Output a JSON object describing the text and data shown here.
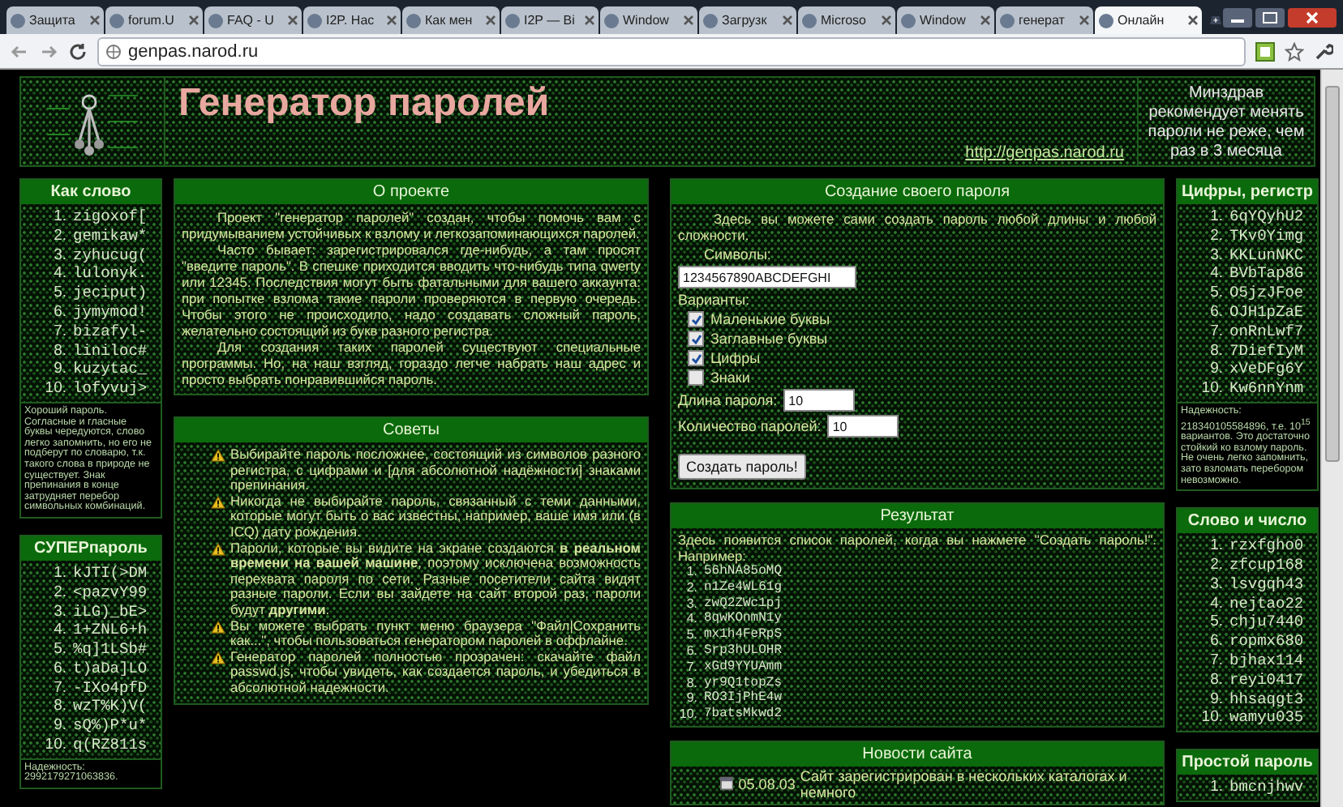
{
  "browser": {
    "tabs": [
      {
        "label": "Защита",
        "selected": false
      },
      {
        "label": "forum.U",
        "selected": false
      },
      {
        "label": "FAQ - U",
        "selected": false
      },
      {
        "label": "I2P. Нас",
        "selected": false
      },
      {
        "label": "Как мен",
        "selected": false
      },
      {
        "label": "I2P — Bi",
        "selected": false
      },
      {
        "label": "Window",
        "selected": false
      },
      {
        "label": "Загрузк",
        "selected": false
      },
      {
        "label": "Microso",
        "selected": false
      },
      {
        "label": "Window",
        "selected": false
      },
      {
        "label": "генерат",
        "selected": false
      },
      {
        "label": "Онлайн",
        "selected": true
      }
    ],
    "address": "genpas.narod.ru"
  },
  "header": {
    "title": "Генератор паролей",
    "link": "http://genpas.narod.ru",
    "notice": "Минздрав рекомендует менять пароли не реже, чем раз в 3 месяца"
  },
  "left_column": [
    {
      "title": "Как слово",
      "items": [
        [
          "1.",
          "zigoxof["
        ],
        [
          "2.",
          "gemikaw*"
        ],
        [
          "3.",
          "zyhucug("
        ],
        [
          "4.",
          "lulonyk."
        ],
        [
          "5.",
          "jeciput)"
        ],
        [
          "6.",
          "jymymod!"
        ],
        [
          "7.",
          "bizafyl-"
        ],
        [
          "8.",
          "liniloc#"
        ],
        [
          "9.",
          "kuzytac_"
        ],
        [
          "10.",
          "lofyvuj>"
        ]
      ],
      "note": "Хороший пароль. Согласные и гласные буквы чередуются, слово легко запомнить, но его не подберут по словарю, т.к. такого слова в природе не существует. Знак препинания в конце затрудняет перебор символьных комбинаций."
    },
    {
      "title": "СУПЕРпароль",
      "items": [
        [
          "1.",
          "kJTI(>DM"
        ],
        [
          "2.",
          "<pazvY99"
        ],
        [
          "3.",
          "iLG)_bE>"
        ],
        [
          "4.",
          "1+ZNL6+h"
        ],
        [
          "5.",
          "%q]1LSb#"
        ],
        [
          "6.",
          "t)aDa]LO"
        ],
        [
          "7.",
          "-IXo4pfD"
        ],
        [
          "8.",
          "wzT%K)V("
        ],
        [
          "9.",
          "sQ%)P*u*"
        ],
        [
          "10.",
          "q(RZ811s"
        ]
      ],
      "note": "Надежность: 2992179271063836."
    }
  ],
  "about": {
    "title": "О проекте",
    "paragraphs": [
      "Проект \"генератор паролей\" создан, чтобы помочь вам с придумыванием устойчивых к взлому и легкозапоминающихся паролей.",
      "Часто бывает: зарегистрировался где-нибудь, а там просят \"введите пароль\". В спешке приходится вводить что-нибудь типа qwerty или 12345. Последствия могут быть фатальными для вашего аккаунта: при попытке взлома такие пароли проверяются в первую очередь. Чтобы этого не происходило, надо создавать сложный пароль, желательно состоящий из букв разного регистра.",
      "Для создания таких паролей существуют специальные программы. Но, на наш взгляд, гораздо легче набрать наш адрес и просто выбрать понравившийся пароль."
    ]
  },
  "tips": {
    "title": "Советы",
    "items": [
      "Выбирайте пароль посложнее, состоящий из символов разного регистра, с цифрами и [для абсолютной надёжности] знаками препинания.",
      "Никогда не выбирайте пароль, связанный с теми данными, которые могут быть о вас известны, например, ваше имя или (в ICQ) дату рождения.",
      "Пароли, которые вы видите на экране создаются **в реальном времени на вашей машине**, поэтому исключена возможность перехвата пароля по сети. Разные посетители сайта видят разные пароли. Если вы зайдете на сайт второй раз, пароли будут **другими**.",
      "Вы можете выбрать пункт меню браузера \"Файл|Сохранить как...\", чтобы пользоваться генератором паролей в оффлайне.",
      "Генератор паролей полностью прозрачен: скачайте файл passwd.js, чтобы увидеть, как создается пароль, и убедиться в абсолютной надежности."
    ]
  },
  "create": {
    "title": "Создание своего пароля",
    "intro": "Здесь вы можете сами создать пароль любой длины и любой сложности.",
    "symbols_label": "Символы:",
    "symbols_value": "1234567890ABCDEFGHI",
    "options_label": "Варианты:",
    "options": [
      {
        "label": "Маленькие буквы",
        "checked": true
      },
      {
        "label": "Заглавные буквы",
        "checked": true
      },
      {
        "label": "Цифры",
        "checked": true
      },
      {
        "label": "Знаки",
        "checked": false
      }
    ],
    "length_label": "Длина пароля:",
    "length_value": "10",
    "count_label": "Количество паролей:",
    "count_value": "10",
    "button": "Создать пароль!"
  },
  "result": {
    "title": "Результат",
    "intro": "Здесь появится список паролей, когда вы нажмете \"Создать пароль!\". Например:",
    "items": [
      [
        "1.",
        "56hNA85oMQ"
      ],
      [
        "2.",
        "n1Ze4WL61g"
      ],
      [
        "3.",
        "zwQ2ZWc1pj"
      ],
      [
        "4.",
        "8qwKOnmN1y"
      ],
      [
        "5.",
        "mx1h4FeRpS"
      ],
      [
        "6.",
        "Srp3hULOHR"
      ],
      [
        "7.",
        "xGd9YYUAmm"
      ],
      [
        "8.",
        "yr9Q1topZs"
      ],
      [
        "9.",
        "RO3IjPhE4w"
      ],
      [
        "10.",
        "7batsMkwd2"
      ]
    ]
  },
  "news": {
    "title": "Новости сайта",
    "items": [
      {
        "date": "05.08.03",
        "text": "Сайт зарегистрирован в нескольких каталогах и немного"
      }
    ]
  },
  "right_column": [
    {
      "title": "Цифры, регистр",
      "items": [
        [
          "1.",
          "6qYQyhU2"
        ],
        [
          "2.",
          "TKv0Yimg"
        ],
        [
          "3.",
          "KKLunNKC"
        ],
        [
          "4.",
          "BVbTap8G"
        ],
        [
          "5.",
          "O5jzJFoe"
        ],
        [
          "6.",
          "OJH1pZaE"
        ],
        [
          "7.",
          "onRnLwf7"
        ],
        [
          "8.",
          "7DiefIyM"
        ],
        [
          "9.",
          "xVeDFg6Y"
        ],
        [
          "10.",
          "Kw6nnYnm"
        ]
      ],
      "note": "Надежность: 218340105584896, т.е. 10$^{15}$ вариантов. Это достаточно стойкий ко взлому пароль. Не очень легко запомнить, зато взломать перебором невозможно."
    },
    {
      "title": "Слово и число",
      "items": [
        [
          "1.",
          "rzxfgho0"
        ],
        [
          "2.",
          "zfcup168"
        ],
        [
          "3.",
          "lsvgqh43"
        ],
        [
          "4.",
          "nejtao22"
        ],
        [
          "5.",
          "chju7440"
        ],
        [
          "6.",
          "ropmx680"
        ],
        [
          "7.",
          "bjhax114"
        ],
        [
          "8.",
          "reyi0417"
        ],
        [
          "9.",
          "hhsaqgt3"
        ],
        [
          "10.",
          "wamyu035"
        ]
      ]
    },
    {
      "title": "Простой пароль",
      "items": [
        [
          "1.",
          "bmcnjhwv"
        ]
      ]
    }
  ]
}
